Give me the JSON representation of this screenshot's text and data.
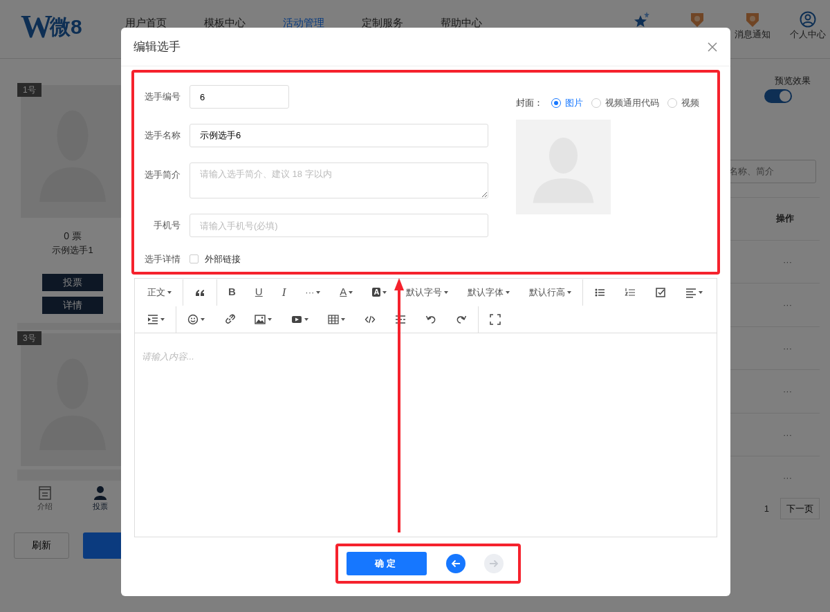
{
  "header": {
    "logo": {
      "mark": "W",
      "text": "微8"
    },
    "nav": [
      {
        "label": "用户首页",
        "selected": false
      },
      {
        "label": "模板中心",
        "selected": false
      },
      {
        "label": "活动管理",
        "selected": true
      },
      {
        "label": "定制服务",
        "selected": false
      },
      {
        "label": "帮助中心",
        "selected": false
      }
    ],
    "notifications_label": "消息通知",
    "profile_label": "个人中心"
  },
  "background": {
    "cards": [
      {
        "number": "1号",
        "votes": "0 票",
        "name": "示例选手1",
        "vote_button": "投票",
        "details_button": "详情"
      },
      {
        "number": "3号"
      }
    ],
    "bottom_tabs": [
      {
        "label": "介绍",
        "selected": false
      },
      {
        "label": "投票",
        "selected": true
      }
    ],
    "refresh_button": "刷新",
    "preview_label": "预览效果",
    "preview_on": true,
    "search_placeholder": "名称、简介",
    "table_header": "操作",
    "row_actions": [
      "···",
      "···",
      "···",
      "···",
      "···",
      "···"
    ],
    "page_number": "1",
    "next_page": "下一页"
  },
  "dialog": {
    "title": "编辑选手",
    "fields": [
      {
        "kind": "short",
        "label": "选手编号",
        "value": "6"
      },
      {
        "kind": "input",
        "label": "选手名称",
        "value": "示例选手6"
      },
      {
        "kind": "textarea",
        "label": "选手简介",
        "placeholder": "请输入选手简介、建议 18 字以内"
      },
      {
        "kind": "input",
        "label": "手机号",
        "placeholder": "请输入手机号(必填)"
      }
    ],
    "details": {
      "label": "选手详情",
      "checkbox": {
        "label": "外部链接",
        "checked": false
      }
    },
    "cover": {
      "label": "封面：",
      "options": [
        {
          "label": "图片",
          "selected": true
        },
        {
          "label": "视频通用代码",
          "selected": false
        },
        {
          "label": "视频",
          "selected": false
        }
      ]
    },
    "toolbar": [
      [
        {
          "kind": "text",
          "label": "正文",
          "dropdown": true
        },
        {
          "kind": "icon",
          "divider_before": true
        },
        {
          "kind": "bold",
          "label": "B",
          "divider_before": true
        },
        {
          "kind": "underline",
          "label": "U"
        },
        {
          "kind": "italic",
          "label": "I"
        },
        {
          "kind": "text",
          "label": "···",
          "dropdown": true
        },
        {
          "kind": "underline",
          "label": "A",
          "dropdown": true
        },
        {
          "kind": "boxed",
          "label": "A",
          "dropdown": true
        },
        {
          "kind": "text",
          "label": "默认字号",
          "dropdown": true
        },
        {
          "kind": "text",
          "label": "默认字体",
          "dropdown": true
        },
        {
          "kind": "text",
          "label": "默认行高",
          "dropdown": true
        },
        {
          "kind": "icon",
          "divider_before": true
        },
        {
          "kind": "icon"
        },
        {
          "kind": "icon"
        },
        {
          "kind": "icon",
          "dropdown": true
        }
      ],
      [
        {
          "kind": "icon",
          "dropdown": true
        },
        {
          "kind": "icon",
          "dropdown": true,
          "divider_before": true
        },
        {
          "kind": "icon"
        },
        {
          "kind": "icon",
          "dropdown": true
        },
        {
          "kind": "icon",
          "dropdown": true
        },
        {
          "kind": "icon",
          "dropdown": true
        },
        {
          "kind": "icon"
        },
        {
          "kind": "icon"
        },
        {
          "kind": "icon"
        },
        {
          "kind": "icon"
        },
        {
          "kind": "icon",
          "divider_before": true
        }
      ]
    ],
    "editor_placeholder": "请输入内容...",
    "confirm_button": "确定",
    "prev_disabled": false,
    "next_disabled": true
  }
}
